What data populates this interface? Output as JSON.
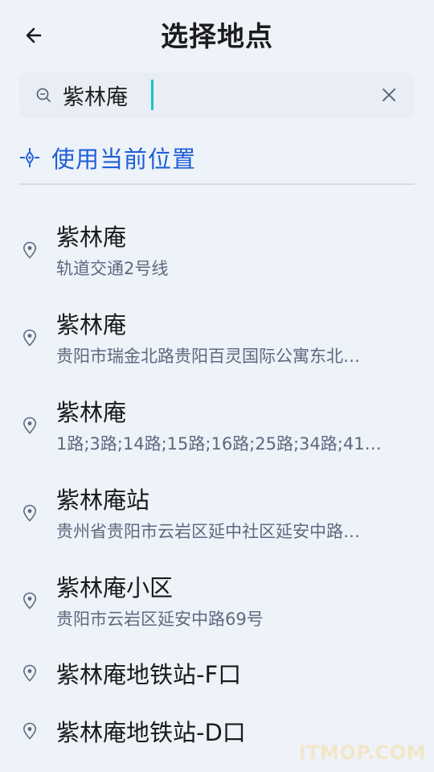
{
  "header": {
    "title": "选择地点",
    "back_icon": "arrow-left-icon"
  },
  "search": {
    "value": "紫林庵",
    "icon": "search-icon",
    "clear_icon": "close-icon"
  },
  "current_location": {
    "label": "使用当前位置",
    "icon": "location-crosshair-icon",
    "color": "#1f5fd6"
  },
  "results": [
    {
      "title": "紫林庵",
      "subtitle": "轨道交通2号线"
    },
    {
      "title": "紫林庵",
      "subtitle": "贵阳市瑞金北路贵阳百灵国际公寓东北…"
    },
    {
      "title": "紫林庵",
      "subtitle": "1路;3路;14路;15路;16路;25路;34路;41…"
    },
    {
      "title": "紫林庵站",
      "subtitle": "贵州省贵阳市云岩区延中社区延安中路…"
    },
    {
      "title": "紫林庵小区",
      "subtitle": "贵阳市云岩区延安中路69号"
    },
    {
      "title": "紫林庵地铁站-F口",
      "subtitle": ""
    },
    {
      "title": "紫林庵地铁站-D口",
      "subtitle": ""
    }
  ],
  "watermark": "ITMOP.COM"
}
